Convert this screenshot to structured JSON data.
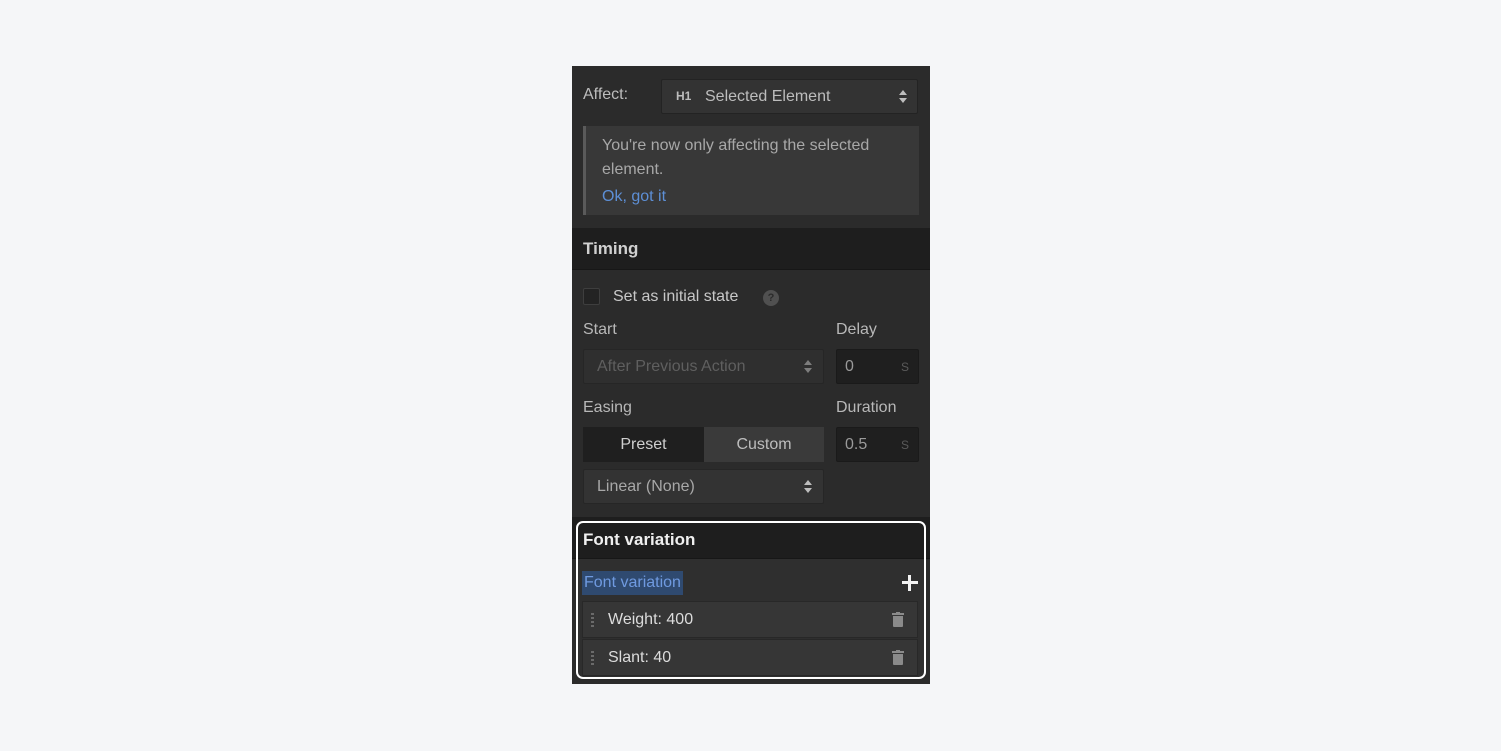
{
  "affect": {
    "label": "Affect:",
    "element_tag": "H1",
    "selected": "Selected Element"
  },
  "notice": {
    "text": "You're now only affecting the selected element.",
    "link": "Ok, got it"
  },
  "timing": {
    "title": "Timing",
    "initial_state_label": "Set as initial state",
    "help": "?",
    "start_label": "Start",
    "start_value": "After Previous Action",
    "delay_label": "Delay",
    "delay_value": "0",
    "delay_unit": "S",
    "easing_label": "Easing",
    "preset_label": "Preset",
    "custom_label": "Custom",
    "duration_label": "Duration",
    "duration_value": "0.5",
    "duration_unit": "S",
    "easing_value": "Linear (None)"
  },
  "font_variation": {
    "title": "Font variation",
    "list_label": "Font variation",
    "items": [
      {
        "label": "Weight: 400"
      },
      {
        "label": "Slant: 40"
      }
    ]
  },
  "colors": {
    "accent_link": "#5d8fd6",
    "highlight_border": "#ffffff",
    "panel_bg": "#2b2b2b"
  }
}
